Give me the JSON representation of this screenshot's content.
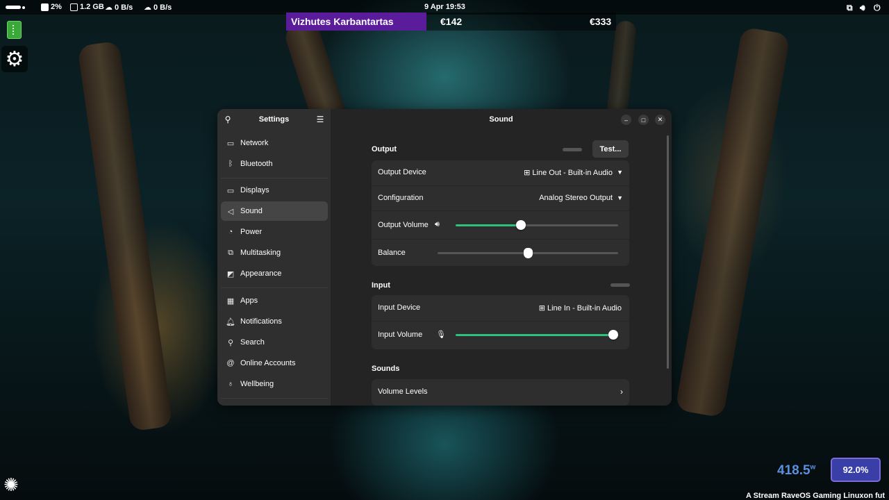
{
  "topbar": {
    "cpu": "2%",
    "memory": "1.2 GB",
    "download": "0 B/s",
    "upload": "0 B/s",
    "clock": "9 Apr  19:53",
    "icons": [
      "network-icon",
      "volume-icon",
      "power-icon"
    ]
  },
  "ticker": {
    "name": "Vizhutes Karbantartas",
    "value1": "€142",
    "value2": "€333"
  },
  "settings": {
    "sidebar_title": "Settings",
    "nav": [
      {
        "label": "Network",
        "icon": "network-icon"
      },
      {
        "label": "Bluetooth",
        "icon": "bluetooth-icon"
      },
      {
        "label": "Displays",
        "icon": "display-icon"
      },
      {
        "label": "Sound",
        "icon": "sound-icon"
      },
      {
        "label": "Power",
        "icon": "power-icon"
      },
      {
        "label": "Multitasking",
        "icon": "multitasking-icon"
      },
      {
        "label": "Appearance",
        "icon": "appearance-icon"
      },
      {
        "label": "Apps",
        "icon": "apps-icon"
      },
      {
        "label": "Notifications",
        "icon": "bell-icon"
      },
      {
        "label": "Search",
        "icon": "search-icon"
      },
      {
        "label": "Online Accounts",
        "icon": "at-icon"
      },
      {
        "label": "Wellbeing",
        "icon": "wellbeing-icon"
      }
    ],
    "active_nav": "Sound",
    "content_title": "Sound",
    "output": {
      "title": "Output",
      "test_label": "Test...",
      "device_label": "Output Device",
      "device_value": "Line Out - Built-in Audio",
      "config_label": "Configuration",
      "config_value": "Analog Stereo Output",
      "volume_label": "Output Volume",
      "volume_level": 0.4,
      "balance_label": "Balance",
      "balance_level": 0.5
    },
    "input": {
      "title": "Input",
      "device_label": "Input Device",
      "device_value": "Line In - Built-in Audio",
      "volume_label": "Input Volume",
      "volume_level": 1.0
    },
    "sounds": {
      "title": "Sounds",
      "volume_levels_label": "Volume Levels"
    }
  },
  "overlay": {
    "power_value": "418.5",
    "power_unit": "w",
    "battery": "92.0%",
    "stream_text": "A Stream RaveOS Gaming Linuxon fut"
  },
  "colors": {
    "accent": "#2ec27e",
    "ticker_bg": "#5a1c9a",
    "battery_bg": "#3a3fa8",
    "power_text": "#5b8fe0"
  }
}
